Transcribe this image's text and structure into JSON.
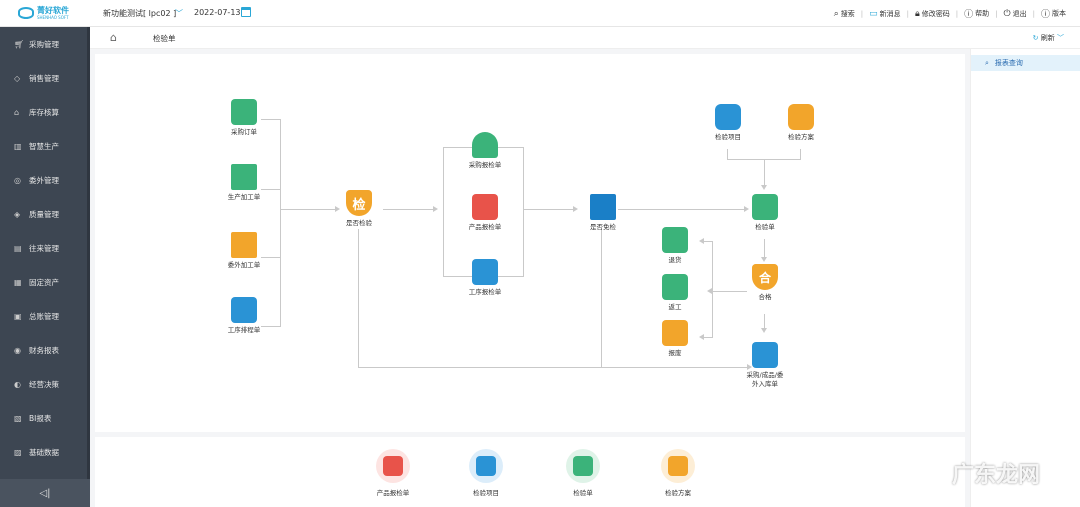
{
  "app": {
    "brand": "菁好软件",
    "brand_sub": "SHENHAO SOFT",
    "company": "新功能测试[ lpc02 ]",
    "date": "2022-07-13"
  },
  "topbar": {
    "search": "搜索",
    "messages": "新消息",
    "change_password": "修改密码",
    "help": "帮助",
    "logout": "退出",
    "version": "版本"
  },
  "sidebar": {
    "items": [
      {
        "label": "采购管理",
        "icon": "cart-icon"
      },
      {
        "label": "销售管理",
        "icon": "tag-icon"
      },
      {
        "label": "库存核算",
        "icon": "warehouse-icon"
      },
      {
        "label": "智慧生产",
        "icon": "factory-icon"
      },
      {
        "label": "委外管理",
        "icon": "outsource-icon"
      },
      {
        "label": "质量管理",
        "icon": "quality-icon"
      },
      {
        "label": "往来管理",
        "icon": "ledger-icon"
      },
      {
        "label": "固定资产",
        "icon": "asset-icon"
      },
      {
        "label": "总账管理",
        "icon": "book-icon"
      },
      {
        "label": "财务报表",
        "icon": "report-icon"
      },
      {
        "label": "经营决策",
        "icon": "decision-icon"
      },
      {
        "label": "BI报表",
        "icon": "bi-icon"
      },
      {
        "label": "基础数据",
        "icon": "data-icon"
      }
    ]
  },
  "breadcrumb": {
    "current": "检验单",
    "refresh": "刷新"
  },
  "right_panel": {
    "tab": "报表查询"
  },
  "flow": {
    "purchase_order": "采购订单",
    "production_order": "生产加工单",
    "outsource_order": "委外加工单",
    "process_plan": "工序排程单",
    "need_inspect": "是否检验",
    "purchase_report": "采购报检单",
    "product_report": "产品报检单",
    "process_report": "工序报检单",
    "exempt": "是否免检",
    "inspect_item": "检验项目",
    "inspect_plan": "检验方案",
    "inspect_sheet": "检验单",
    "qualified": "合格",
    "return_goods": "退货",
    "rework": "返工",
    "scrap": "报废",
    "stock_in_line1": "采购/成品/委",
    "stock_in_line2": "外入库单",
    "qualified_glyph": "合",
    "inspect_glyph": "检"
  },
  "shortcuts": [
    "产品报检单",
    "检验项目",
    "检验单",
    "检验方案"
  ],
  "watermark": "广东龙网",
  "colors": {
    "accent": "#2aa7d6",
    "sidebar": "#3d4652",
    "green": "#3bb37a",
    "orange": "#f2a52b",
    "red": "#e8534a",
    "blue": "#2a93d5"
  }
}
